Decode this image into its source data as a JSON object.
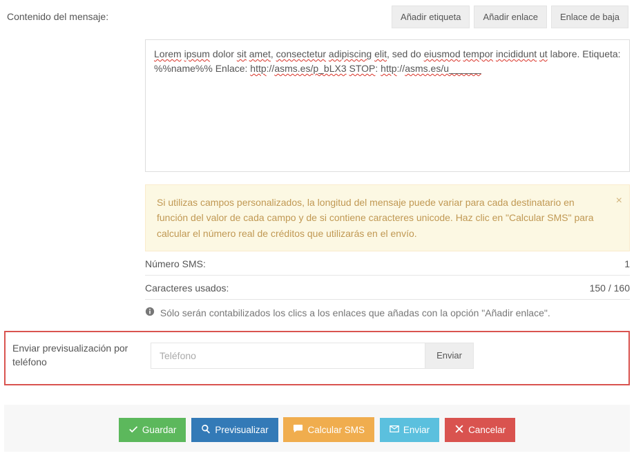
{
  "labels": {
    "content": "Contenido del mensaje:",
    "preview": "Enviar previsualización por teléfono"
  },
  "toolbar": {
    "add_tag": "Añadir etiqueta",
    "add_link": "Añadir enlace",
    "unsub_link": "Enlace de baja"
  },
  "message": {
    "tokens": [
      {
        "t": "Lorem",
        "s": true
      },
      {
        "t": " "
      },
      {
        "t": "ipsum",
        "s": true
      },
      {
        "t": " dolor "
      },
      {
        "t": "sit",
        "s": true
      },
      {
        "t": " "
      },
      {
        "t": "amet",
        "s": true
      },
      {
        "t": ", "
      },
      {
        "t": "consectetur",
        "s": true
      },
      {
        "t": " "
      },
      {
        "t": "adipiscing",
        "s": true
      },
      {
        "t": " "
      },
      {
        "t": "elit",
        "s": true
      },
      {
        "t": ", sed do "
      },
      {
        "t": "eiusmod",
        "s": true
      },
      {
        "t": " "
      },
      {
        "t": "tempor",
        "s": true
      },
      {
        "t": " "
      },
      {
        "t": "incididunt",
        "s": true
      },
      {
        "t": " "
      },
      {
        "t": "ut",
        "s": true
      },
      {
        "t": " labore. Etiqueta: %%name%% Enlace: "
      },
      {
        "t": "http",
        "s": true
      },
      {
        "t": "://"
      },
      {
        "t": "asms.es/p_bLX3",
        "s": true
      },
      {
        "t": " "
      },
      {
        "t": "STOP",
        "s": true
      },
      {
        "t": ": "
      },
      {
        "t": "http",
        "s": true
      },
      {
        "t": "://"
      },
      {
        "t": "asms.es/u______",
        "s": true
      }
    ]
  },
  "alert": {
    "text": "Si utilizas campos personalizados, la longitud del mensaje puede variar para cada destinatario en función del valor de cada campo y de si contiene caracteres unicode. Haz clic en \"Calcular SMS\" para calcular el número real de créditos que utilizarás en el envío."
  },
  "stats": {
    "sms_label": "Número SMS:",
    "sms_value": "1",
    "chars_label": "Caracteres usados:",
    "chars_value": "150 / 160"
  },
  "hint": "Sólo serán contabilizados los clics a los enlaces que añadas con la opción \"Añadir enlace\".",
  "preview": {
    "placeholder": "Teléfono",
    "button": "Enviar"
  },
  "actions": {
    "save": "Guardar",
    "preview": "Previsualizar",
    "calc": "Calcular SMS",
    "send": "Enviar",
    "cancel": "Cancelar"
  }
}
